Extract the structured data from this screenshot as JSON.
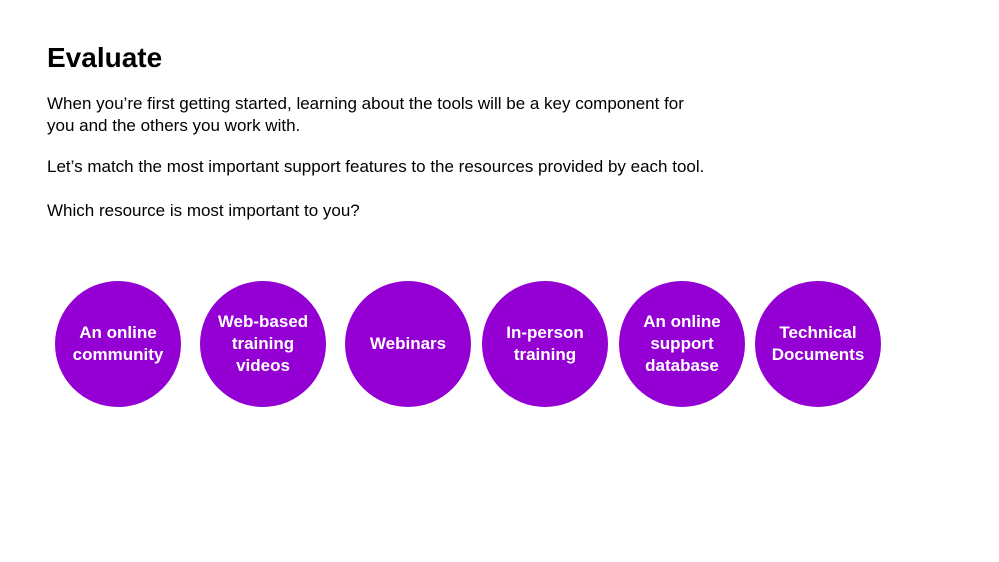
{
  "slide": {
    "title": "Evaluate",
    "paragraphs": [
      "When you’re first getting started, learning about the tools will be a key component for\nyou and the others you work with.",
      "Let’s match the most important support features to the resources provided by each tool.",
      "Which resource is most important to you?"
    ]
  },
  "theme": {
    "circle_color": "#9400D3",
    "text_color": "#000000",
    "background": "#ffffff"
  },
  "options": [
    {
      "label": "An online\ncommunity"
    },
    {
      "label": "Web-based\ntraining\nvideos"
    },
    {
      "label": "Webinars"
    },
    {
      "label": "In-person\ntraining"
    },
    {
      "label": "An online\nsupport\ndatabase"
    },
    {
      "label": "Technical\nDocuments"
    }
  ]
}
